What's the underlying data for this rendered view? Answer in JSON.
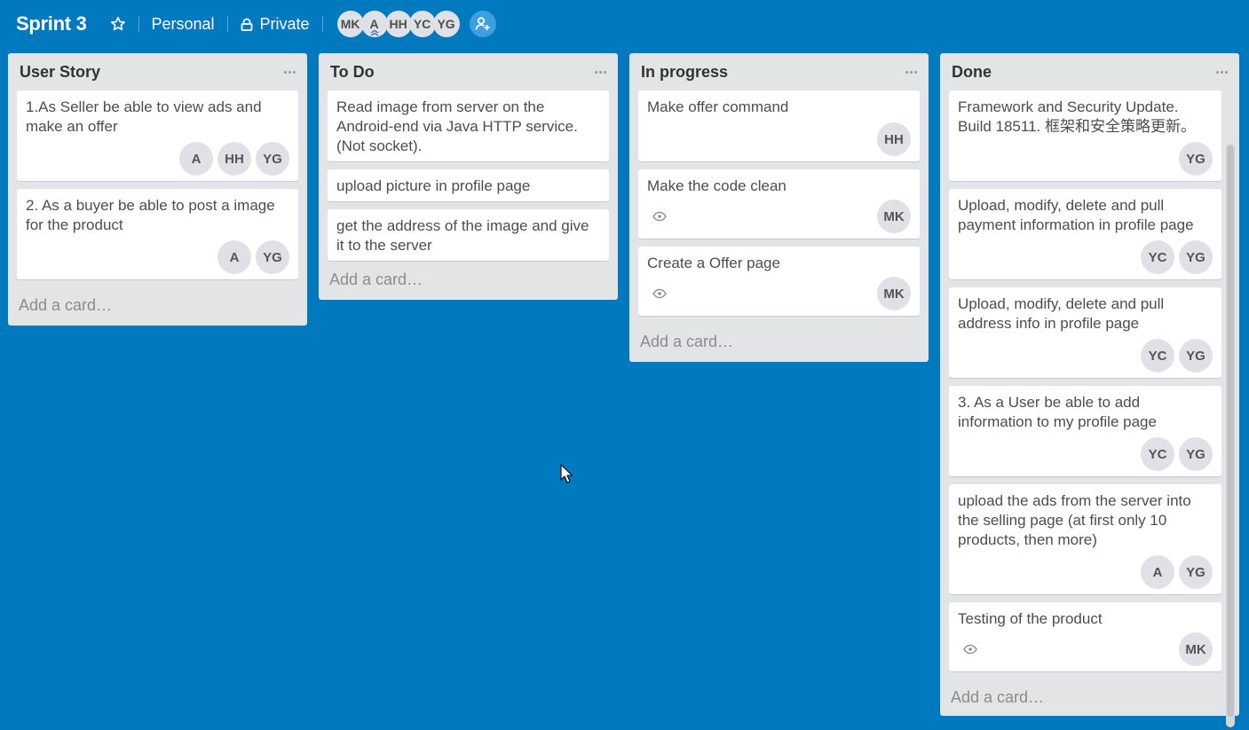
{
  "header": {
    "title": "Sprint 3",
    "star_icon": "star-icon",
    "team": "Personal",
    "visibility": "Private",
    "visibility_icon": "lock-icon",
    "members": [
      "MK",
      "A",
      "HH",
      "YC",
      "YG"
    ],
    "invite_icon": "add-member-icon"
  },
  "lists": [
    {
      "title": "User Story",
      "add_label": "Add a card…",
      "cards": [
        {
          "text": "1.As Seller be able to view ads and make an offer",
          "members": [
            "A",
            "HH",
            "YG"
          ],
          "watch": false
        },
        {
          "text": "2. As a buyer be able to post a image for the product",
          "members": [
            "A",
            "YG"
          ],
          "watch": false
        }
      ]
    },
    {
      "title": "To Do",
      "add_label": "Add a card…",
      "cards": [
        {
          "text": "Read image from server on the Android-end via Java HTTP service. (Not socket).",
          "members": [],
          "watch": false
        },
        {
          "text": "upload picture in profile page",
          "members": [],
          "watch": false
        },
        {
          "text": "get the address of the image and give it to the server",
          "members": [],
          "watch": false
        }
      ]
    },
    {
      "title": "In progress",
      "add_label": "Add a card…",
      "cards": [
        {
          "text": "Make offer command",
          "members": [
            "HH"
          ],
          "watch": false
        },
        {
          "text": "Make the code clean",
          "members": [
            "MK"
          ],
          "watch": true
        },
        {
          "text": "Create a Offer page",
          "members": [
            "MK"
          ],
          "watch": true
        }
      ]
    },
    {
      "title": "Done",
      "add_label": "Add a card…",
      "cards": [
        {
          "text": "Framework and Security Update. Build 18511. 框架和安全策略更新。",
          "members": [
            "YG"
          ],
          "watch": false
        },
        {
          "text": "Upload, modify, delete and pull payment information in profile page",
          "members": [
            "YC",
            "YG"
          ],
          "watch": false
        },
        {
          "text": "Upload, modify, delete and pull address info in profile page",
          "members": [
            "YC",
            "YG"
          ],
          "watch": false
        },
        {
          "text": "3. As a User be able to add information to my profile page",
          "members": [
            "YC",
            "YG"
          ],
          "watch": false
        },
        {
          "text": "upload the ads from the server into the selling page (at first only 10 products, then more)",
          "members": [
            "A",
            "YG"
          ],
          "watch": false
        },
        {
          "text": "Testing of the product",
          "members": [
            "MK"
          ],
          "watch": true
        }
      ]
    }
  ],
  "colors": {
    "board_bg": "#0079bf",
    "list_bg": "#e2e4e6",
    "avatar_bg": "#dfe1e6"
  }
}
